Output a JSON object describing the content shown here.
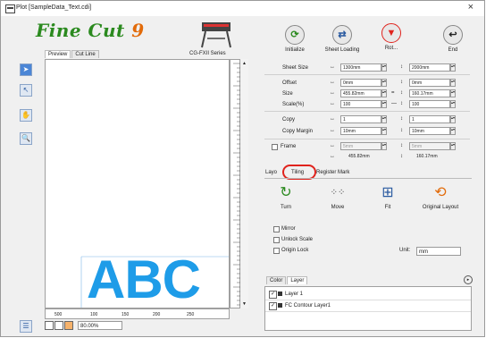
{
  "window": {
    "title": "Plot [SampleData_Text.cdi]",
    "close": "×"
  },
  "logo": {
    "main": "Fine Cut ",
    "nine": "9"
  },
  "view_tabs": [
    "Preview",
    "Cut Line"
  ],
  "machine_label": "CG-FXII Series",
  "top_buttons": [
    {
      "label": "Initialize",
      "icon": "initialize-icon",
      "glyph": "⟳"
    },
    {
      "label": "Sheet Loading",
      "icon": "sheet-loading-icon",
      "glyph": "⇄"
    },
    {
      "label": "Rot...",
      "icon": "plot-icon",
      "glyph": "▼"
    },
    {
      "label": "End",
      "icon": "end-icon",
      "glyph": "↩"
    }
  ],
  "params": {
    "sheet_size": {
      "label": "Sheet Size",
      "w": "1300mm",
      "h": "2000mm"
    },
    "offset": {
      "label": "Offset",
      "w": "0mm",
      "h": "0mm"
    },
    "size": {
      "label": "Size",
      "w": "455.82mm",
      "h": "160.17mm"
    },
    "scale": {
      "label": "Scale(%)",
      "w": "100",
      "h": "100"
    },
    "copy": {
      "label": "Copy",
      "w": "1",
      "h": "1"
    },
    "copy_margin": {
      "label": "Copy Margin",
      "w": "10mm",
      "h": "10mm"
    },
    "frame": {
      "label": "Frame",
      "w": "5mm",
      "h": "5mm"
    },
    "totals": {
      "w": "455.82mm",
      "h": "160.17mm"
    }
  },
  "lower_tabs": [
    "Layo",
    "Tiling",
    "Register Mark"
  ],
  "tile_tools": [
    {
      "label": "Turn",
      "icon": "turn-icon"
    },
    {
      "label": "Move",
      "icon": "move-icon"
    },
    {
      "label": "Fit",
      "icon": "fit-icon"
    },
    {
      "label": "Original Layout",
      "icon": "original-layout-icon"
    }
  ],
  "options": [
    "Mirror",
    "Unlock Scale",
    "Origin Lock"
  ],
  "unit": {
    "label": "Unit:",
    "value": "mm"
  },
  "layer_tabs": [
    "Color",
    "Layer"
  ],
  "layers": [
    {
      "name": "Layer 1",
      "checked": "✓"
    },
    {
      "name": "FC Contour Layer1",
      "checked": "✓"
    }
  ],
  "canvas_text": "ABC",
  "ruler": [
    "500",
    "100",
    "150",
    "200",
    "250"
  ],
  "zoom": "80.00%",
  "colors": {
    "accent": "#1e9ce8",
    "logo": "#2b8a1f",
    "highlight": "#e0231d"
  }
}
